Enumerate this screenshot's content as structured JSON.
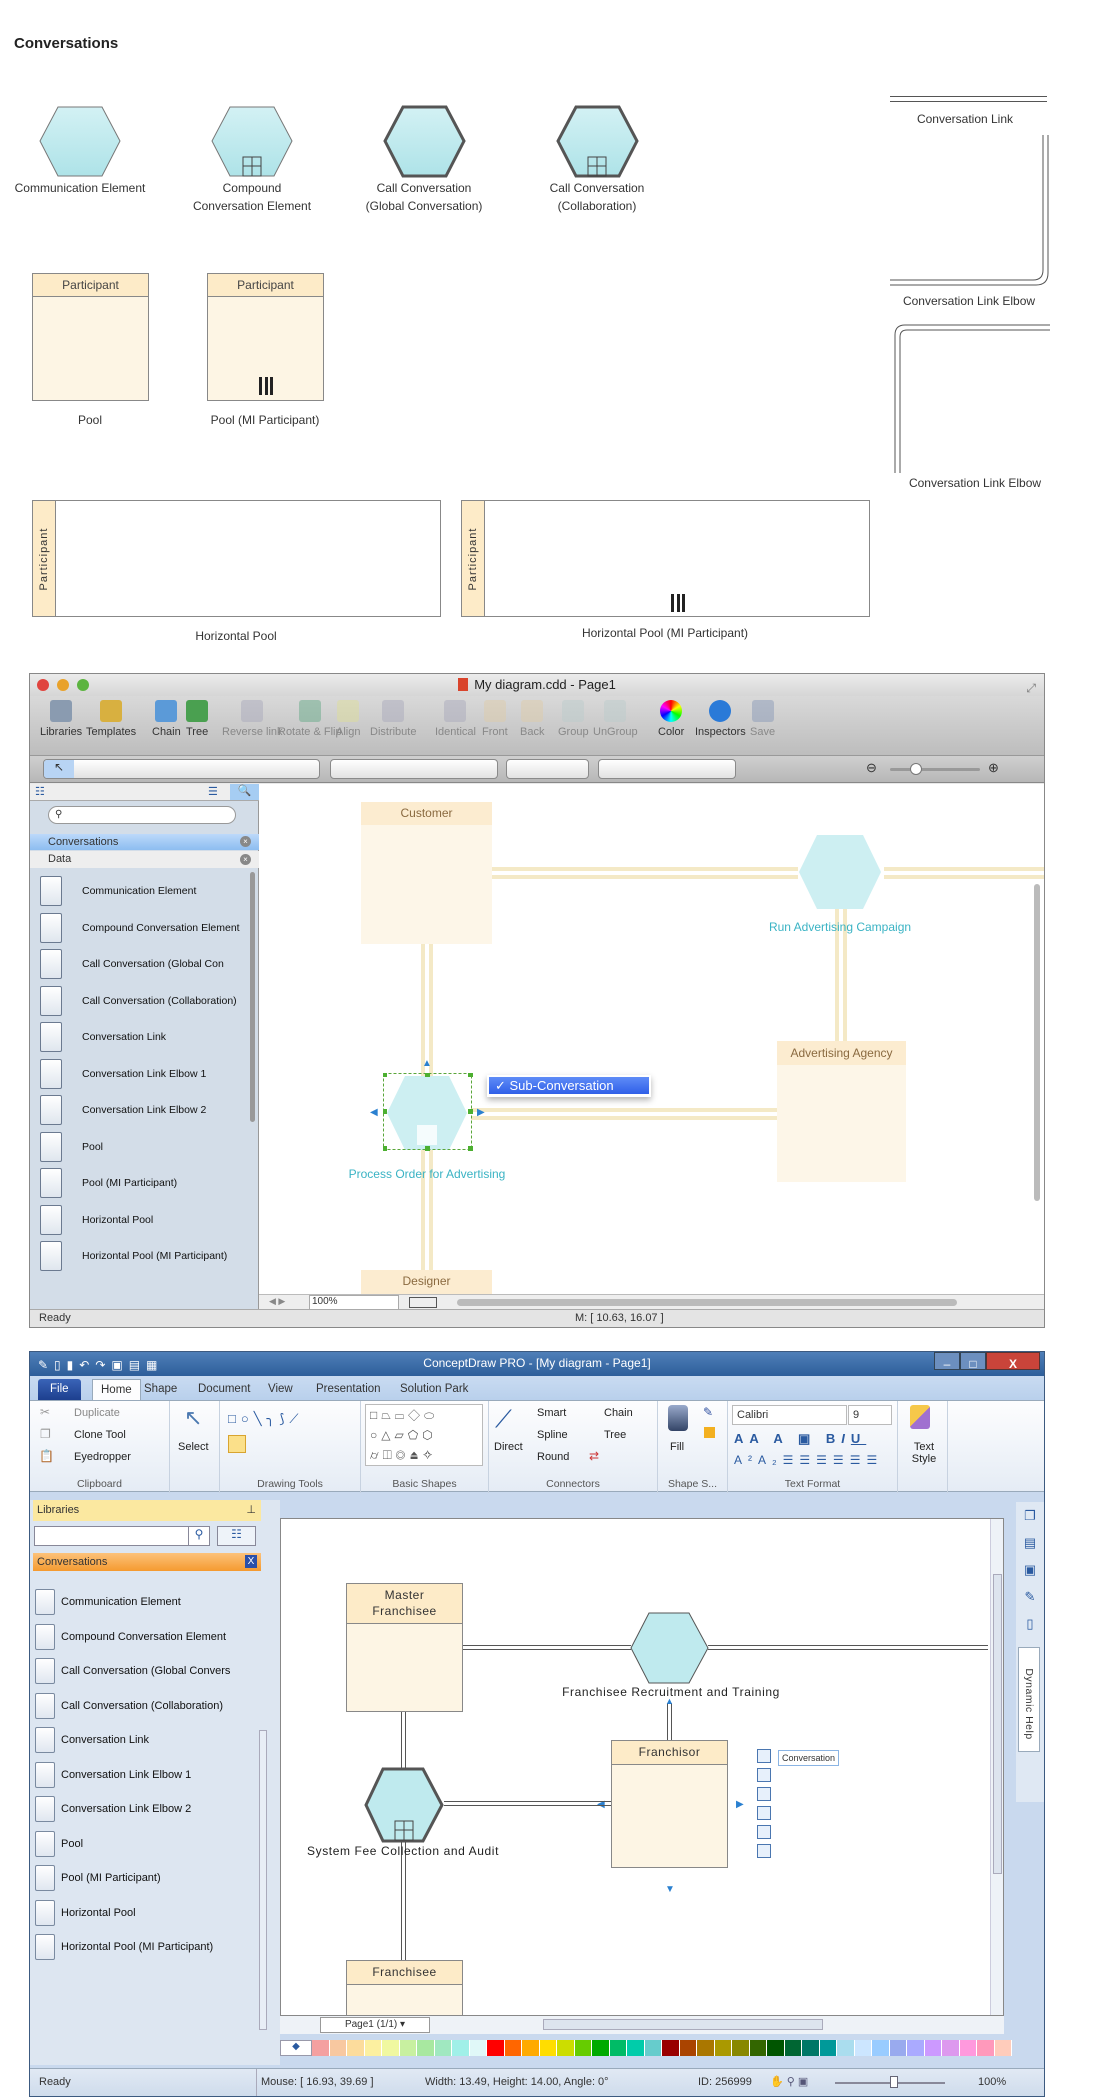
{
  "stencil": {
    "title": "Conversations",
    "shapes": [
      {
        "label1": "Communication Element",
        "label2": ""
      },
      {
        "label1": "Compound",
        "label2": "Conversation Element"
      },
      {
        "label1": "Call Conversation",
        "label2": "(Global Conversation)"
      },
      {
        "label1": "Call Conversation",
        "label2": "(Collaboration)"
      }
    ],
    "pool_header": "Participant",
    "pool_label": "Pool",
    "pool_mi_label": "Pool (MI Participant)",
    "hpool_label": "Horizontal Pool",
    "hpool_mi_label": "Horizontal Pool (MI Participant)",
    "link_label": "Conversation Link",
    "elbow1_label": "Conversation Link Elbow",
    "elbow2_label": "Conversation Link Elbow"
  },
  "colors": {
    "hex_fill": "#bfeaee",
    "pool_fill": "#fdf5e4",
    "pool_header": "#fdebc8",
    "selected_blue": "#3d6ff0",
    "teal_text": "#3ab3c4"
  },
  "mac": {
    "title": "My diagram.cdd - Page1",
    "toolbar": [
      {
        "label": "Libraries",
        "dis": false
      },
      {
        "label": "Templates",
        "dis": false
      },
      {
        "label": "Chain",
        "dis": false
      },
      {
        "label": "Tree",
        "dis": false
      },
      {
        "label": "Reverse link",
        "dis": true
      },
      {
        "label": "Rotate & Flip",
        "dis": true
      },
      {
        "label": "Align",
        "dis": true
      },
      {
        "label": "Distribute",
        "dis": true
      },
      {
        "label": "Identical",
        "dis": true
      },
      {
        "label": "Front",
        "dis": true
      },
      {
        "label": "Back",
        "dis": true
      },
      {
        "label": "Group",
        "dis": true
      },
      {
        "label": "UnGroup",
        "dis": true
      },
      {
        "label": "Color",
        "dis": false
      },
      {
        "label": "Inspectors",
        "dis": false
      },
      {
        "label": "Save",
        "dis": true
      }
    ],
    "search_placeholder": "",
    "libraries": [
      {
        "name": "Conversations",
        "active": true
      },
      {
        "name": "Data",
        "active": false
      }
    ],
    "items": [
      "Communication Element",
      "Compound Conversation Element",
      "Call Conversation (Global Con",
      "Call Conversation (Collaboration)",
      "Conversation Link",
      "Conversation Link Elbow 1",
      "Conversation Link Elbow 2",
      "Pool",
      "Pool (MI Participant)",
      "Horizontal Pool",
      "Horizontal Pool (MI Participant)"
    ],
    "canvas": {
      "customer": "Customer",
      "run_campaign": "Run Advertising Campaign",
      "agency": "Advertising Agency",
      "process_order": "Process Order for Advertising",
      "designer": "Designer",
      "popup_item": "✓ Sub-Conversation"
    },
    "zoom": "100%",
    "status": "Ready",
    "mouse": "M: [ 10.63, 16.07 ]"
  },
  "win": {
    "title": "ConceptDraw PRO - [My diagram - Page1]",
    "tabs": [
      "File",
      "Home",
      "Shape",
      "Document",
      "View",
      "Presentation",
      "Solution Park"
    ],
    "clipboard": {
      "duplicate": "Duplicate",
      "clone": "Clone Tool",
      "eyedropper": "Eyedropper",
      "group": "Clipboard"
    },
    "select": "Select",
    "drawing_tools": "Drawing Tools",
    "basic_shapes": "Basic Shapes",
    "connectors": {
      "direct": "Direct",
      "smart": "Smart",
      "spline": "Spline",
      "round": "Round",
      "chain": "Chain",
      "tree": "Tree",
      "group": "Connectors"
    },
    "shape_style": {
      "fill": "Fill",
      "group": "Shape S..."
    },
    "text_format": {
      "font": "Calibri",
      "size": "9",
      "group": "Text Format"
    },
    "text_style": "Text Style",
    "libraries_header": "Libraries",
    "search_value": "",
    "library_name": "Conversations",
    "items": [
      "Communication Element",
      "Compound Conversation Element",
      "Call Conversation (Global Convers",
      "Call Conversation (Collaboration)",
      "Conversation Link",
      "Conversation Link Elbow 1",
      "Conversation Link Elbow 2",
      "Pool",
      "Pool (MI Participant)",
      "Horizontal Pool",
      "Horizontal Pool (MI Participant)"
    ],
    "canvas": {
      "master": "Master Franchisee",
      "recruitment": "Franchisee Recruitment and Training",
      "franchisor": "Franchisor",
      "system_fee": "System Fee Collection and Audit",
      "franchisee": "Franchisee",
      "quick_label": "Conversation"
    },
    "page_tab": "Page1 (1/1)",
    "dynamic_help": "Dynamic Help",
    "palette": [
      "#f4a0a0",
      "#f8c8a0",
      "#fcdc9c",
      "#fcf0a0",
      "#f0f8a0",
      "#c8f0a0",
      "#a8e8a0",
      "#a0e8c0",
      "#a0f0e8",
      "#e0f8f8",
      "#ff0000",
      "#ff6600",
      "#ffaa00",
      "#ffdd00",
      "#ccdd00",
      "#66cc00",
      "#00aa00",
      "#00bb66",
      "#00ccaa",
      "#66cccc",
      "#990000",
      "#aa4400",
      "#aa7700",
      "#aa9900",
      "#888800",
      "#336600",
      "#005500",
      "#006633",
      "#007766",
      "#009999",
      "#aaddee",
      "#cce6ff",
      "#99ccff",
      "#99aaee",
      "#aaaaff",
      "#cc99ff",
      "#dd99ee",
      "#ff99dd",
      "#ff99bb",
      "#ffccbb"
    ],
    "status": {
      "ready": "Ready",
      "mouse": "Mouse: [ 16.93, 39.69 ]",
      "size": "Width: 13.49,  Height: 14.00,  Angle: 0°",
      "id": "ID: 256999",
      "zoom": "100%"
    }
  }
}
